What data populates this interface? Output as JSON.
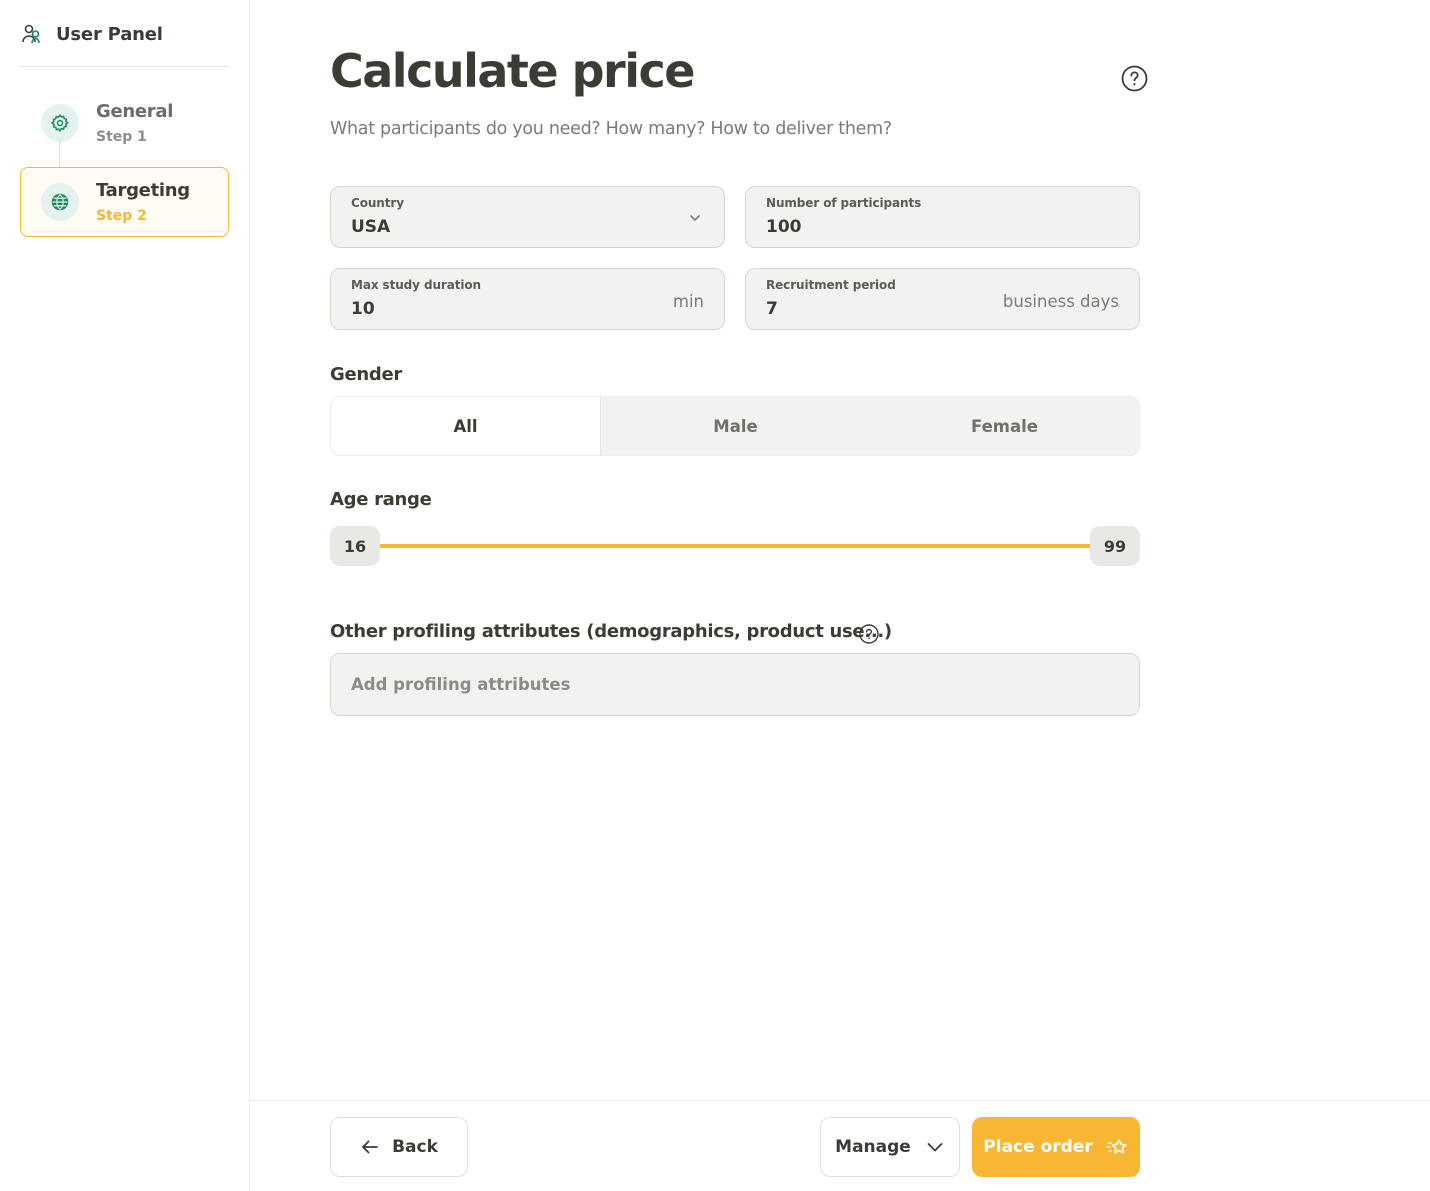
{
  "sidebar": {
    "title": "User Panel",
    "steps": [
      {
        "name": "General",
        "sub": "Step 1"
      },
      {
        "name": "Targeting",
        "sub": "Step 2"
      }
    ]
  },
  "main": {
    "title": "Calculate price",
    "subtitle": "What participants do you need? How many? How to deliver them?",
    "fields": {
      "country": {
        "label": "Country",
        "value": "USA"
      },
      "participants": {
        "label": "Number of participants",
        "value": "100"
      },
      "duration": {
        "label": "Max study duration",
        "value": "10",
        "unit": "min"
      },
      "recruitment": {
        "label": "Recruitment period",
        "value": "7",
        "unit": "business days"
      }
    },
    "gender": {
      "label": "Gender",
      "options": [
        "All",
        "Male",
        "Female"
      ],
      "selected": "All"
    },
    "age": {
      "label": "Age range",
      "min": "16",
      "max": "99"
    },
    "profiling": {
      "label": "Other profiling attributes (demographics, product use...)",
      "placeholder": "Add profiling attributes"
    }
  },
  "footer": {
    "back": "Back",
    "manage": "Manage",
    "order": "Place order"
  },
  "colors": {
    "accent": "#f7b733",
    "green": "#1f8a5f",
    "text": "#3b3d35"
  }
}
